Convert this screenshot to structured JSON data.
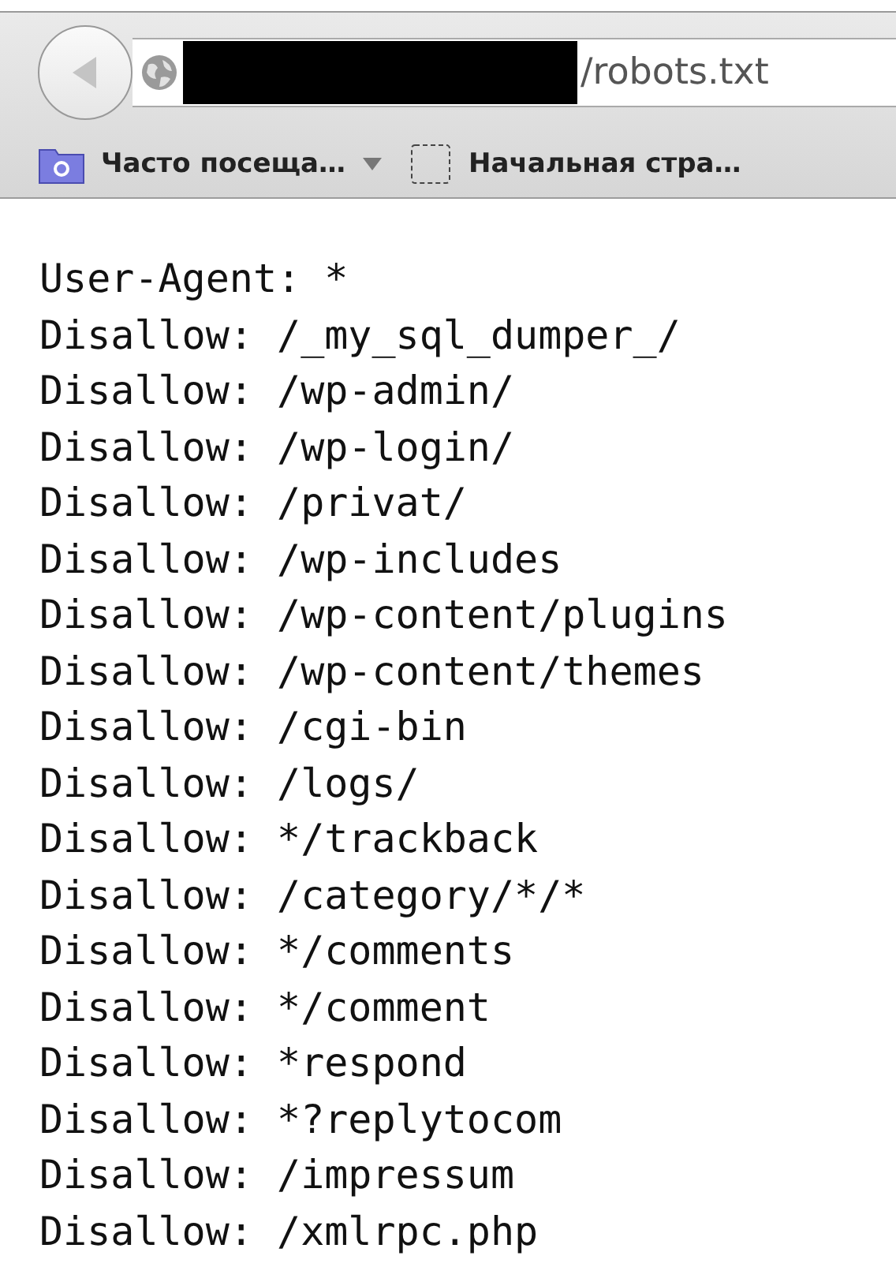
{
  "toolbar": {
    "address": "/robots.txt"
  },
  "bookmarks": [
    {
      "kind": "folder",
      "label": "Часто посеща…",
      "dropdown": true
    },
    {
      "kind": "page",
      "label": "Начальная стра…",
      "dropdown": false
    }
  ],
  "lines": [
    "User-Agent: *",
    "Disallow: /_my_sql_dumper_/",
    "Disallow: /wp-admin/",
    "Disallow: /wp-login/",
    "Disallow: /privat/",
    "Disallow: /wp-includes",
    "Disallow: /wp-content/plugins",
    "Disallow: /wp-content/themes",
    "Disallow: /cgi-bin",
    "Disallow: /logs/",
    "Disallow: */trackback",
    "Disallow: /category/*/*",
    "Disallow: */comments",
    "Disallow: */comment",
    "Disallow: *respond",
    "Disallow: *?replytocom",
    "Disallow: /impressum",
    "Disallow: /xmlrpc.php"
  ]
}
